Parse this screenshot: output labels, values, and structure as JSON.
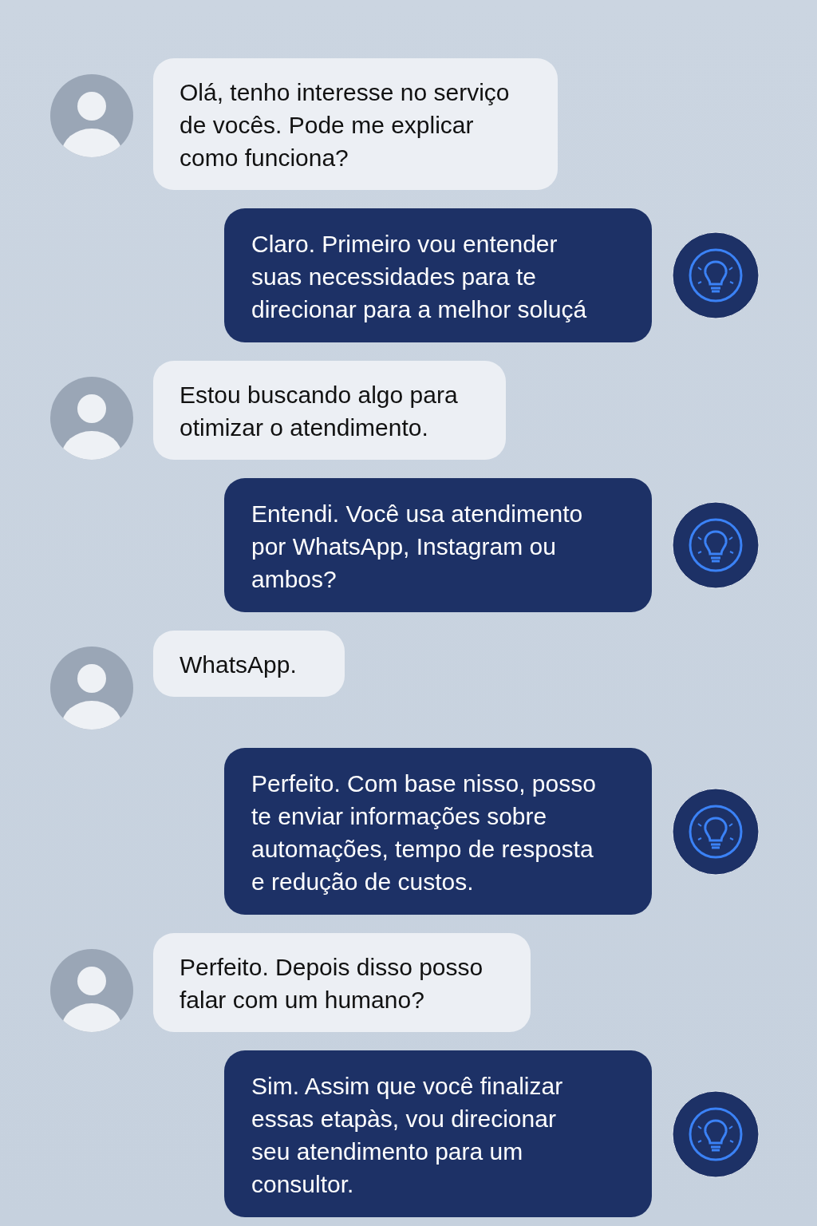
{
  "messages": [
    {
      "kind": "user",
      "lines": [
        "Olá, tenho interesse no serviço",
        "de vocês. Pode me explicar",
        "como funciona?"
      ]
    },
    {
      "kind": "bot",
      "lines": [
        "Claro. Primeiro vou entender",
        "suas necessidades para te",
        "direcionar para a melhor soluçá"
      ]
    },
    {
      "kind": "user",
      "lines": [
        "Estou buscando algo para",
        "otimizar o atendimento."
      ]
    },
    {
      "kind": "bot",
      "lines": [
        "Entendi. Você usa atendimento",
        "por WhatsApp, Instagram ou",
        "ambos?"
      ]
    },
    {
      "kind": "user",
      "lines": [
        "WhatsApp."
      ]
    },
    {
      "kind": "bot",
      "lines": [
        "Perfeito. Com base nisso, posso",
        "te enviar informações sobre",
        "automações, tempo de resposta",
        "e redução de custos."
      ]
    },
    {
      "kind": "user",
      "lines": [
        "Perfeito. Depois disso posso",
        "falar com um humano?"
      ]
    },
    {
      "kind": "bot",
      "lines": [
        "Sim. Assim que você finalizar",
        "essas etapàs, vou direcionar",
        "seu atendimento para um",
        "consultor."
      ]
    }
  ]
}
